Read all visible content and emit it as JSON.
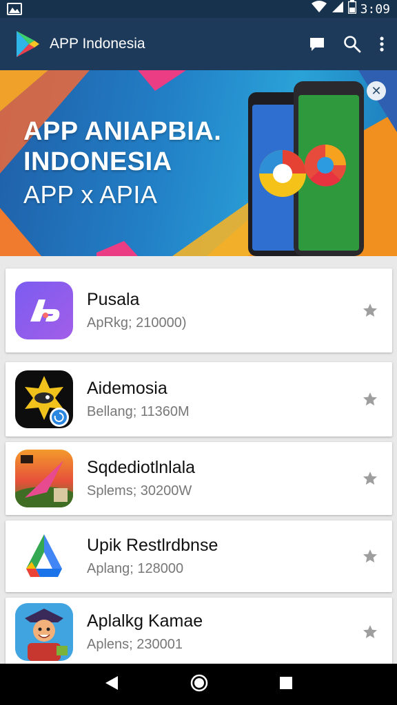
{
  "status_bar": {
    "time": "3:09",
    "icons": [
      "photo-icon",
      "wifi-icon",
      "signal-icon",
      "battery-icon"
    ]
  },
  "app_bar": {
    "title": "APP Indonesia",
    "icons": [
      "play-logo-icon",
      "message-icon",
      "search-icon",
      "more-vert-icon"
    ],
    "color": "#1d3a5a"
  },
  "banner": {
    "line1": "APP ANIAPBIA.",
    "line2": "INDONESIA",
    "line3": "APP x APIA",
    "close_glyph": "✕"
  },
  "apps": [
    {
      "name": "Pusala",
      "meta": "ApRkg; 210000)",
      "icon": "pusala-app-icon"
    },
    {
      "name": "Aidemosia",
      "meta": "Bellang; 11360M",
      "icon": "aidemosia-app-icon"
    },
    {
      "name": "Sqdediotlnlala",
      "meta": "Splems; 30200W",
      "icon": "sqdediotlnlala-app-icon"
    },
    {
      "name": "Upik Restlrdbnse",
      "meta": "Aplang; 128000",
      "icon": "upik-app-icon"
    },
    {
      "name": "Aplalkg Kamae",
      "meta": "Aplens; 230001",
      "icon": "aplalkg-app-icon"
    }
  ],
  "nav_bar": {
    "icons": [
      "back-icon",
      "home-icon",
      "recents-icon"
    ]
  }
}
